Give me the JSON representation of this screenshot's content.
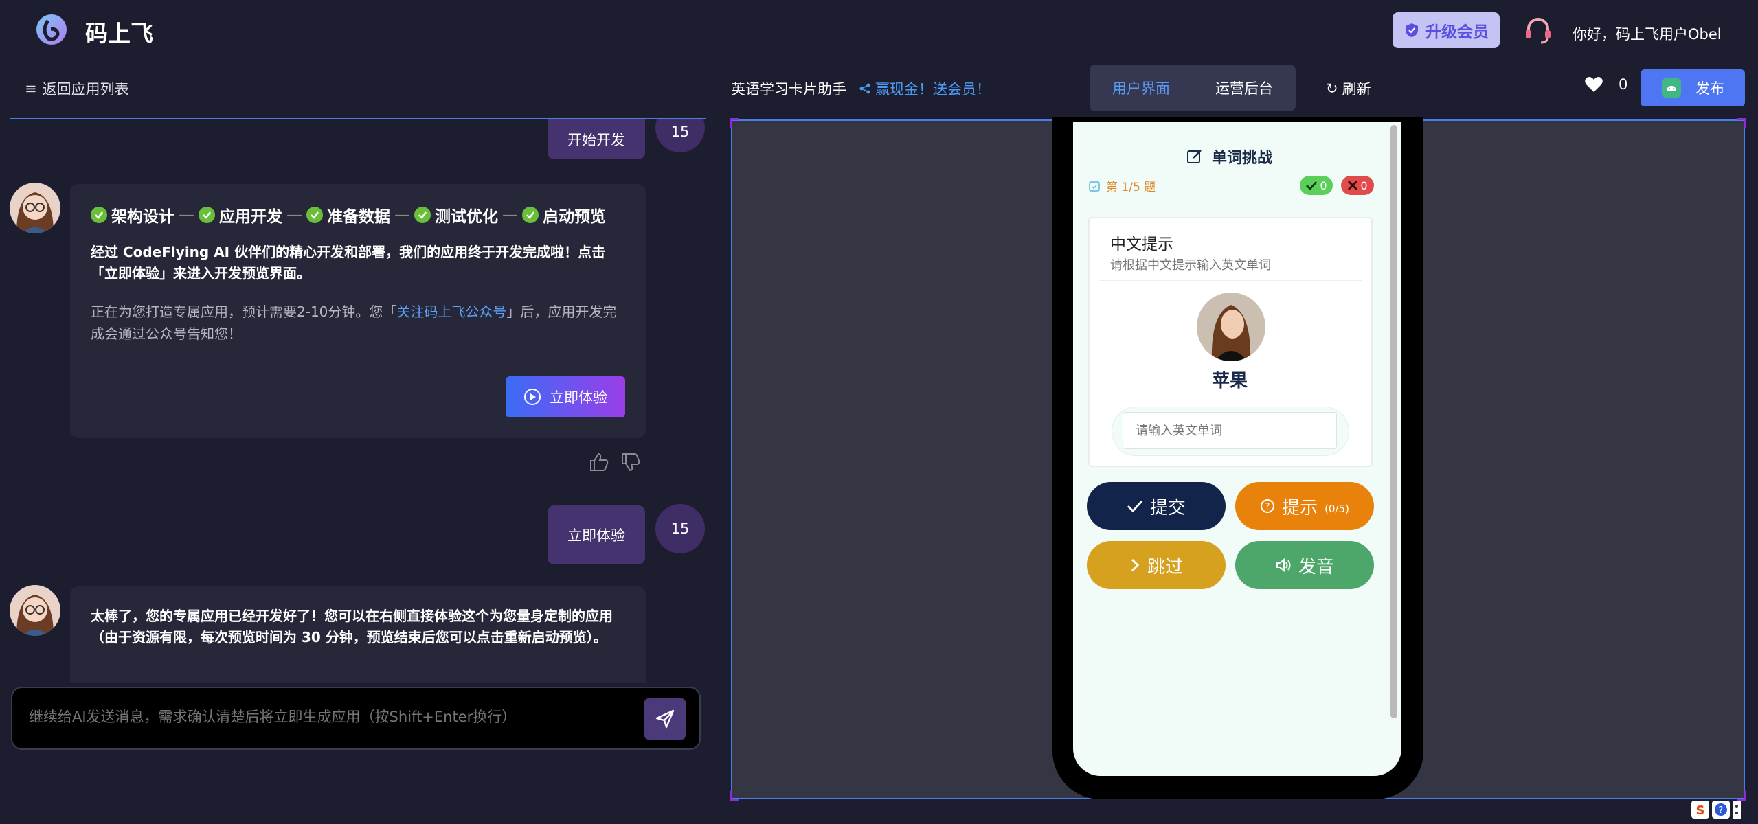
{
  "header": {
    "app_name": "码上飞",
    "upgrade_label": "升级会员",
    "greeting": "你好，码上飞用户Obel"
  },
  "chat": {
    "back_label": "返回应用列表",
    "messages": [
      {
        "role": "user",
        "text": "开始开发",
        "badge": "15"
      },
      {
        "role": "bot",
        "steps": [
          "架构设计",
          "应用开发",
          "准备数据",
          "测试优化",
          "启动预览"
        ],
        "text": "经过 CodeFlying AI 伙伴们的精心开发和部署，我们的应用终于开发完成啦！点击「立即体验」来进入开发预览界面。",
        "sub_before": "正在为您打造专属应用，预计需要2-10分钟。您「",
        "sub_link": "关注码上飞公众号",
        "sub_after": "」后，应用开发完成会通过公众号告知您！",
        "button": "立即体验"
      },
      {
        "role": "user",
        "text": "立即体验",
        "badge": "15"
      },
      {
        "role": "bot",
        "text": "太棒了，您的专属应用已经开发好了！您可以在右侧直接体验这个为您量身定制的应用（由于资源有限，每次预览时间为 30 分钟，预览结束后您可以点击重新启动预览）。"
      }
    ],
    "input_placeholder": "继续给AI发送消息，需求确认清楚后将立即生成应用（按Shift+Enter换行）"
  },
  "preview_header": {
    "app_title": "英语学习卡片助手",
    "promo": "赢现金！送会员！",
    "tabs": [
      {
        "label": "用户界面",
        "active": true
      },
      {
        "label": "运营后台",
        "active": false
      }
    ],
    "refresh_label": "刷新",
    "likes": "0",
    "publish_label": "发布"
  },
  "phone_app": {
    "title": "单词挑战",
    "progress": "第 1/5 题",
    "correct_count": "0",
    "wrong_count": "0",
    "card_title": "中文提示",
    "card_subtitle": "请根据中文提示输入英文单词",
    "word": "苹果",
    "input_placeholder": "请输入英文单词",
    "buttons": {
      "submit": "提交",
      "hint": "提示",
      "hint_count": "(0/5)",
      "skip": "跳过",
      "speak": "发音"
    }
  },
  "colors": {
    "accent": "#4e76f3",
    "submit": "#13244a",
    "hint": "#e8820b",
    "skip": "#d6a11f",
    "speak": "#4da66a",
    "user_bubble": "#45336f"
  }
}
